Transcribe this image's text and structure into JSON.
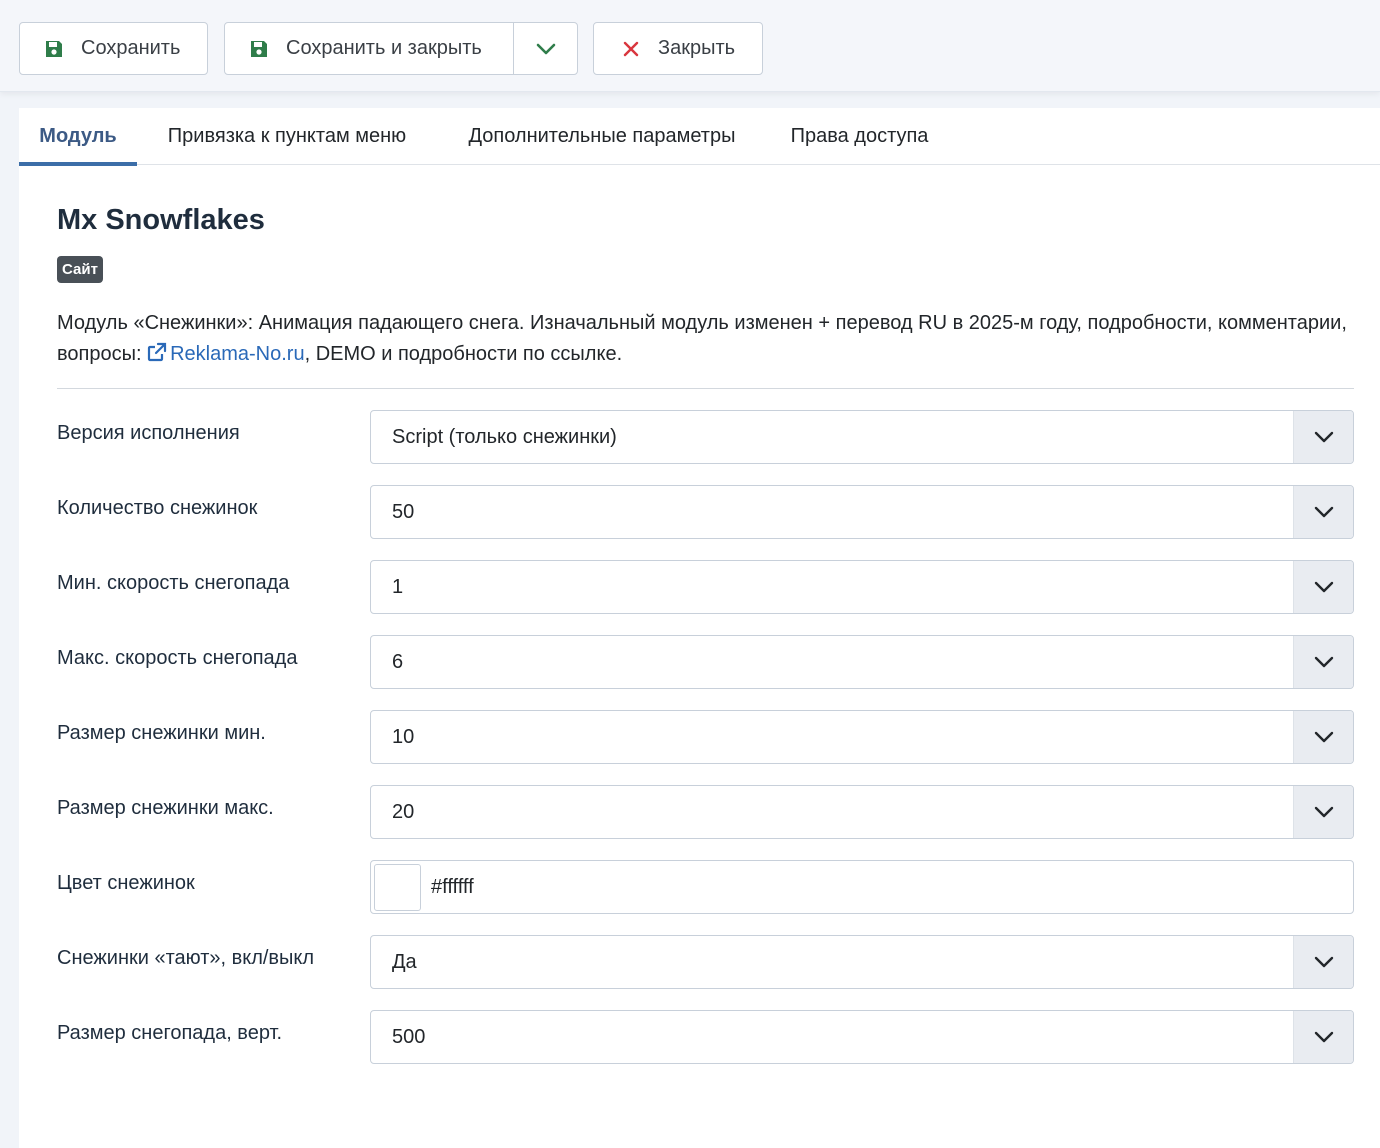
{
  "toolbar": {
    "save_label": "Сохранить",
    "save_close_label": "Сохранить и закрыть",
    "close_label": "Закрыть"
  },
  "tabs": [
    {
      "label": "Модуль",
      "active": true
    },
    {
      "label": "Привязка к пунктам меню",
      "active": false
    },
    {
      "label": "Дополнительные параметры",
      "active": false
    },
    {
      "label": "Права доступа",
      "active": false
    }
  ],
  "module": {
    "title": "Mx Snowflakes",
    "badge": "Сайт",
    "description_before": "Модуль «Снежинки»: Анимация падающего снега. Изначальный модуль изменен + перевод RU в 2025-м году, подробности, комментарии, вопросы: ",
    "link_text": "Reklama-No.ru",
    "description_after": ", DEMO и подробности по ссылке."
  },
  "fields": [
    {
      "label": "Версия исполнения",
      "value": "Script (только снежинки)",
      "type": "select"
    },
    {
      "label": "Количество снежинок",
      "value": "50",
      "type": "select"
    },
    {
      "label": "Мин. скорость снегопада",
      "value": "1",
      "type": "select"
    },
    {
      "label": "Макс. скорость снегопада",
      "value": "6",
      "type": "select"
    },
    {
      "label": "Размер снежинки мин.",
      "value": "10",
      "type": "select"
    },
    {
      "label": "Размер снежинки макс.",
      "value": "20",
      "type": "select"
    },
    {
      "label": "Цвет снежинок",
      "value": "#ffffff",
      "type": "color"
    },
    {
      "label": "Снежинки «тают», вкл/выкл",
      "value": "Да",
      "type": "select"
    },
    {
      "label": "Размер снегопада, верт.",
      "value": "500",
      "type": "select"
    }
  ],
  "colors": {
    "save_icon": "#2f7d4a",
    "close_icon": "#d9363e",
    "accent": "#3c6ea8",
    "link": "#2a69b8"
  },
  "icons": {
    "save": "floppy-disk-icon",
    "dropdown": "chevron-down-icon",
    "close": "x-icon",
    "external_link": "external-link-icon"
  }
}
